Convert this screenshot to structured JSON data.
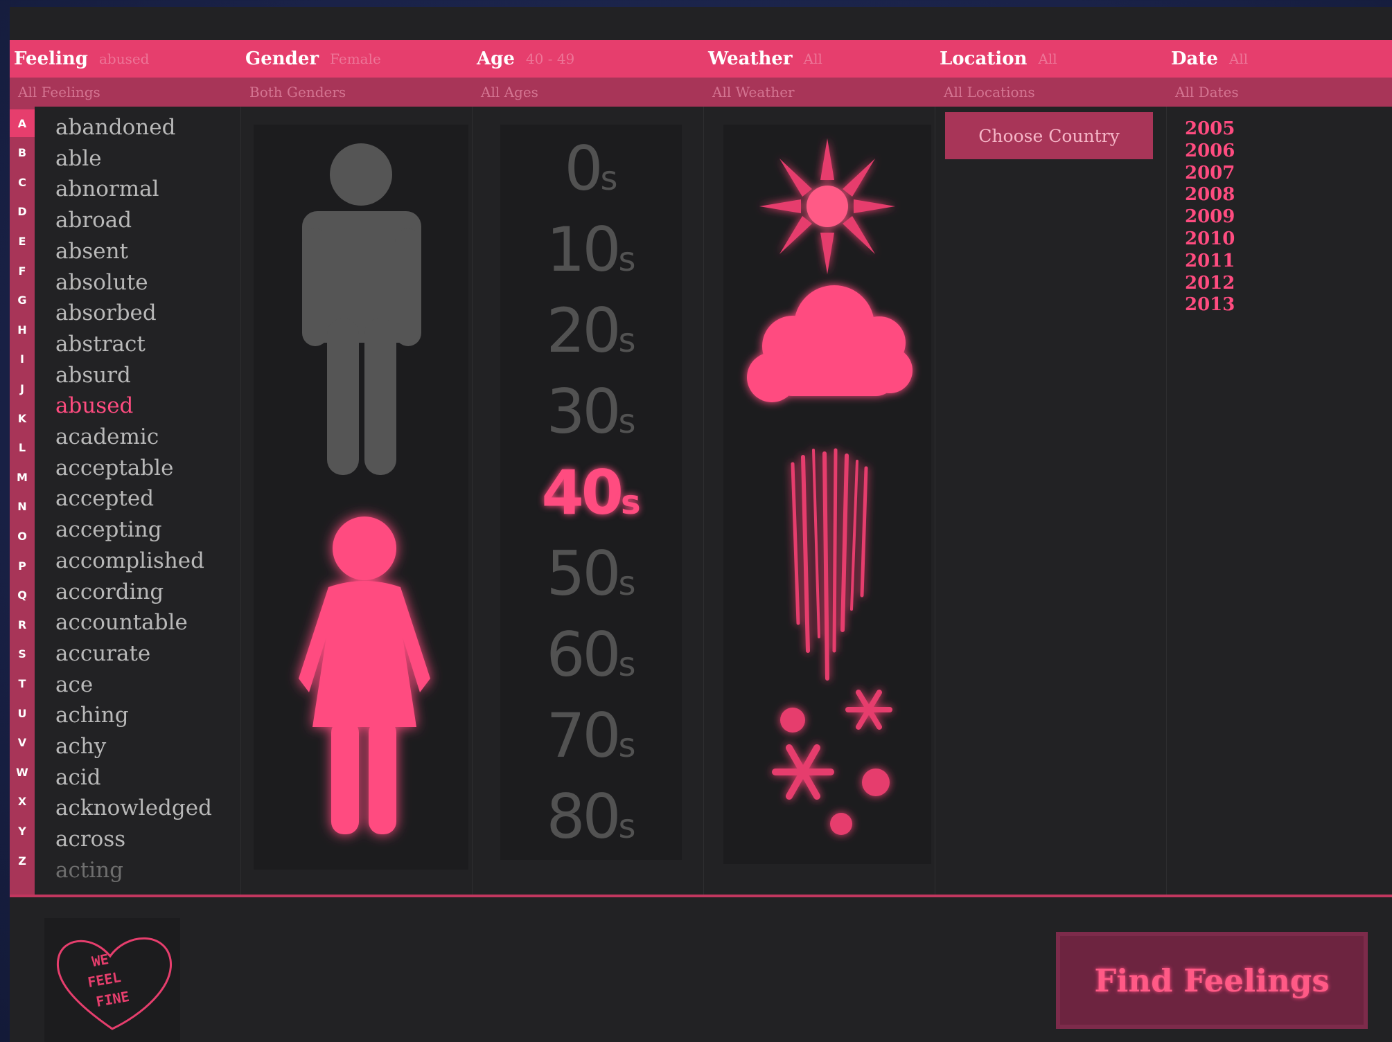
{
  "header": {
    "columns": [
      {
        "name": "Feeling",
        "value": "abused",
        "sub": "All Feelings"
      },
      {
        "name": "Gender",
        "value": "Female",
        "sub": "Both Genders"
      },
      {
        "name": "Age",
        "value": "40 - 49",
        "sub": "All Ages"
      },
      {
        "name": "Weather",
        "value": "All",
        "sub": "All Weather"
      },
      {
        "name": "Location",
        "value": "All",
        "sub": "All Locations"
      },
      {
        "name": "Date",
        "value": "All",
        "sub": "All Dates"
      }
    ]
  },
  "alphabet": [
    "A",
    "B",
    "C",
    "D",
    "E",
    "F",
    "G",
    "H",
    "I",
    "J",
    "K",
    "L",
    "M",
    "N",
    "O",
    "P",
    "Q",
    "R",
    "S",
    "T",
    "U",
    "V",
    "W",
    "X",
    "Y",
    "Z"
  ],
  "active_letter": "A",
  "feelings": [
    "abandoned",
    "able",
    "abnormal",
    "abroad",
    "absent",
    "absolute",
    "absorbed",
    "abstract",
    "absurd",
    "abused",
    "academic",
    "acceptable",
    "accepted",
    "accepting",
    "accomplished",
    "according",
    "accountable",
    "accurate",
    "ace",
    "aching",
    "achy",
    "acid",
    "acknowledged",
    "across",
    "acting"
  ],
  "selected_feeling": "abused",
  "ages": [
    {
      "num": "0",
      "suffix": "s"
    },
    {
      "num": "10",
      "suffix": "s"
    },
    {
      "num": "20",
      "suffix": "s"
    },
    {
      "num": "30",
      "suffix": "s"
    },
    {
      "num": "40",
      "suffix": "s"
    },
    {
      "num": "50",
      "suffix": "s"
    },
    {
      "num": "60",
      "suffix": "s"
    },
    {
      "num": "70",
      "suffix": "s"
    },
    {
      "num": "80",
      "suffix": "s"
    }
  ],
  "selected_age": "40",
  "weather_icons": [
    "sun-icon",
    "cloud-icon",
    "rain-icon",
    "snow-icon"
  ],
  "location": {
    "button_label": "Choose Country"
  },
  "dates": [
    "2005",
    "2006",
    "2007",
    "2008",
    "2009",
    "2010",
    "2011",
    "2012",
    "2013"
  ],
  "footer": {
    "logo_text": [
      "WE",
      "FEEL",
      "FINE"
    ],
    "find_button": "Find Feelings"
  },
  "colors": {
    "accent": "#e63e6d",
    "accent_dark": "#a83558",
    "selected": "#ff4c80",
    "inactive_icon": "#555555",
    "background": "#222224"
  }
}
